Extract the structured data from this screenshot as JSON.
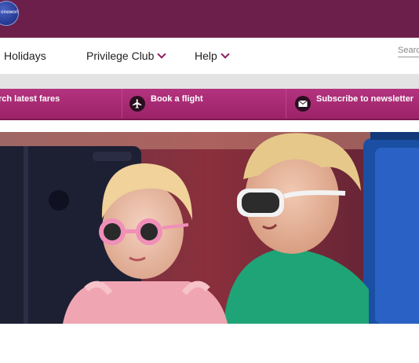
{
  "header": {
    "logo_text": "oneworld"
  },
  "nav": {
    "items": [
      {
        "label": "Holidays",
        "has_dropdown": false
      },
      {
        "label": "Privilege Club",
        "has_dropdown": true
      },
      {
        "label": "Help",
        "has_dropdown": true
      }
    ],
    "search_placeholder": "Search"
  },
  "actions": [
    {
      "label": "rch latest fares",
      "icon": "search-icon"
    },
    {
      "label": "Book a flight",
      "icon": "airplane-icon"
    },
    {
      "label": "Subscribe to newsletter",
      "icon": "envelope-icon"
    }
  ],
  "colors": {
    "topbar": "#6b1f4a",
    "accent": "#8c1d5d",
    "actionbar": "#a8287a"
  },
  "hero": {
    "description_icon": "family-photo"
  }
}
